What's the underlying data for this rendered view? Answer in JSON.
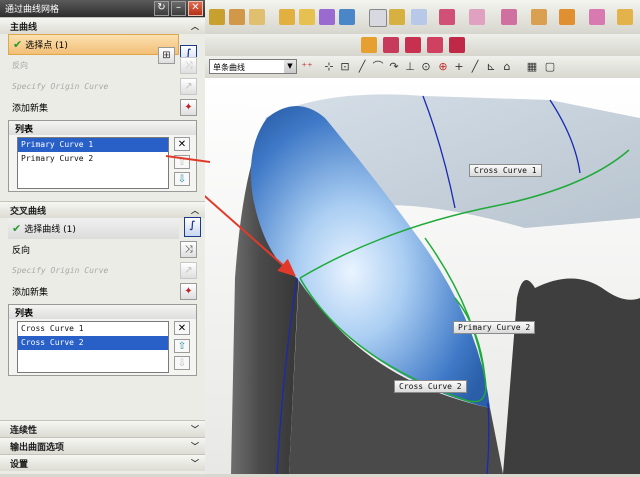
{
  "dialog": {
    "title": "通过曲线网格",
    "primary": {
      "header": "主曲线",
      "select_label": "选择点 (1)",
      "reverse_label": "反向",
      "specify_origin": "Specify Origin Curve",
      "add_new_set": "添加新集",
      "list_header": "列表",
      "items": [
        "Primary Curve  1",
        "Primary Curve  2"
      ]
    },
    "cross": {
      "header": "交叉曲线",
      "select_label": "选择曲线 (1)",
      "reverse_label": "反向",
      "specify_origin": "Specify Origin Curve",
      "add_new_set": "添加新集",
      "list_header": "列表",
      "items": [
        "Cross Curve  1",
        "Cross Curve  2"
      ]
    },
    "sections": [
      "连续性",
      "输出曲面选项",
      "设置"
    ]
  },
  "toolbar": {
    "filter_value": "单条曲线"
  },
  "viewport": {
    "labels": {
      "cross1": "Cross Curve  1",
      "primary2": "Primary Curve  2",
      "cross2": "Cross Curve  2"
    }
  },
  "colors": {
    "accent_orange": "#f2bf77",
    "selection_blue": "#2860c8",
    "curve_green": "#1faa3a",
    "curve_blue": "#1a2ab0",
    "arrow_red": "#e23a2a"
  }
}
